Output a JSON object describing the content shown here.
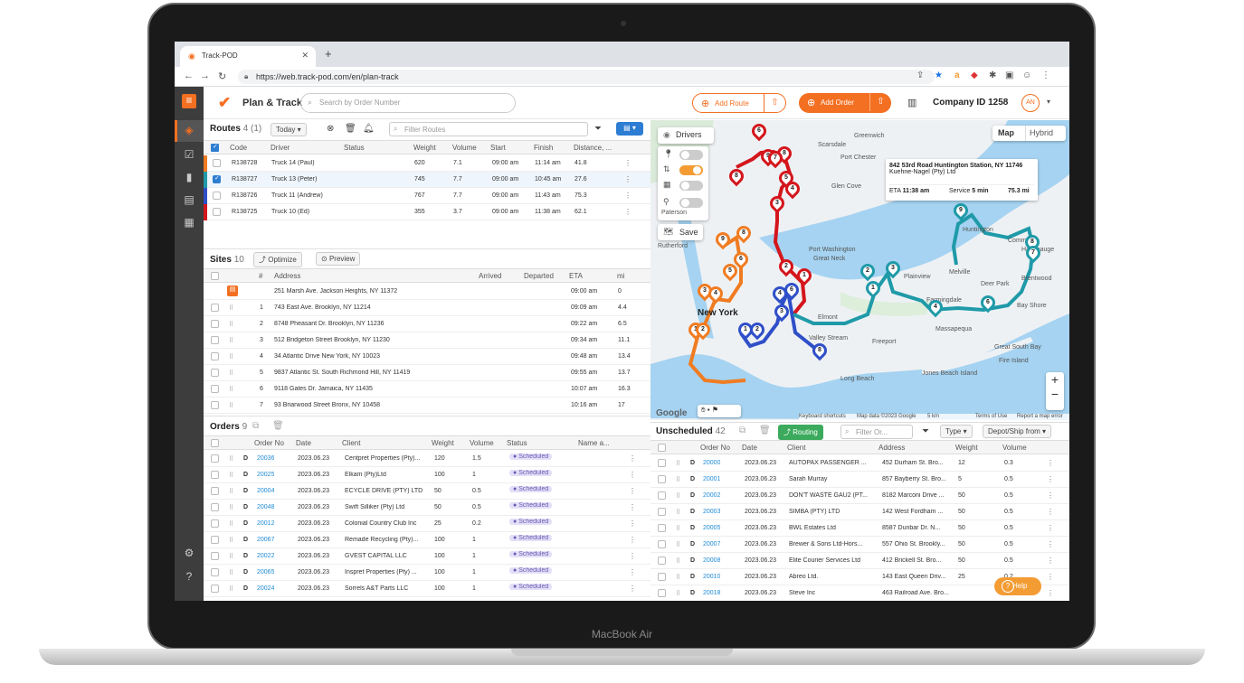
{
  "device": {
    "brand": "MacBook Air"
  },
  "browser": {
    "tab_title": "Track-POD",
    "url": "https://web.track-pod.com/en/plan-track"
  },
  "header": {
    "title": "Plan & Track",
    "search_placeholder": "Search by Order Number",
    "add_route": "Add Route",
    "add_order": "Add Order",
    "company": "Company ID 1258",
    "avatar": "AN"
  },
  "routes": {
    "title": "Routes",
    "count": "4 (1)",
    "period": "Today",
    "filter_placeholder": "Filter Routes",
    "columns": [
      "Code",
      "Driver",
      "Status",
      "Weight",
      "Volume",
      "Start",
      "Finish",
      "Distance, ..."
    ],
    "rows": [
      {
        "code": "R138728",
        "driver": "Truck 14 (Paul)",
        "weight": "620",
        "volume": "7.1",
        "start": "09:00 am",
        "finish": "11:14 am",
        "distance": "41.8",
        "color": "#f07c22",
        "checked": false
      },
      {
        "code": "R138727",
        "driver": "Truck 13 (Peter)",
        "weight": "745",
        "volume": "7.7",
        "start": "09:00 am",
        "finish": "10:45 am",
        "distance": "27.6",
        "color": "#1f9aa8",
        "checked": true
      },
      {
        "code": "R138726",
        "driver": "Truck 11 (Andrew)",
        "weight": "767",
        "volume": "7.7",
        "start": "09:00 am",
        "finish": "11:43 am",
        "distance": "75.3",
        "color": "#2f4fc8",
        "checked": false
      },
      {
        "code": "R138725",
        "driver": "Truck 10 (Ed)",
        "weight": "355",
        "volume": "3.7",
        "start": "09:00 am",
        "finish": "11:38 am",
        "distance": "62.1",
        "color": "#d4161c",
        "checked": false
      }
    ]
  },
  "sites": {
    "title": "Sites",
    "count": "10",
    "optimize": "Optimize",
    "preview": "Preview",
    "columns": [
      "#",
      "Address",
      "Arrived",
      "Departed",
      "ETA",
      "mi"
    ],
    "rows": [
      {
        "n": "",
        "address": "251 Marsh Ave. Jackson Heights, NY 11372",
        "eta": "09:00 am",
        "mi": "0",
        "depot": true
      },
      {
        "n": "1",
        "address": "743 East Ave. Brooklyn, NY 11214",
        "eta": "09:09 am",
        "mi": "4.4"
      },
      {
        "n": "2",
        "address": "8748 Pheasant Dr. Brooklyn, NY 11236",
        "eta": "09:22 am",
        "mi": "6.5"
      },
      {
        "n": "3",
        "address": "512 Bridgeton Street Brooklyn, NY 11230",
        "eta": "09:34 am",
        "mi": "11.1"
      },
      {
        "n": "4",
        "address": "34 Atlantic Drive New York, NY 10023",
        "eta": "09:48 am",
        "mi": "13.4"
      },
      {
        "n": "5",
        "address": "9837 Atlantic St. South Richmond Hill, NY 11419",
        "eta": "09:55 am",
        "mi": "13.7"
      },
      {
        "n": "6",
        "address": "9118 Gates Dr. Jamaica, NY 11435",
        "eta": "10:07 am",
        "mi": "16.3"
      },
      {
        "n": "7",
        "address": "93 Briarwood Street Bronx, NY 10458",
        "eta": "10:16 am",
        "mi": "17"
      }
    ]
  },
  "orders": {
    "title": "Orders",
    "count": "9",
    "columns": [
      "Order No",
      "Date",
      "Client",
      "Weight",
      "Volume",
      "Status",
      "Name a..."
    ],
    "rows": [
      {
        "no": "20036",
        "date": "2023.06.23",
        "client": "Centpret Properties (Pty)...",
        "weight": "120",
        "volume": "1.5",
        "status": "Scheduled"
      },
      {
        "no": "20025",
        "date": "2023.06.23",
        "client": "Elkam (Pty)Ltd",
        "weight": "100",
        "volume": "1",
        "status": "Scheduled"
      },
      {
        "no": "20004",
        "date": "2023.06.23",
        "client": "ECYCLE DRIVE (PTY) LTD",
        "weight": "50",
        "volume": "0.5",
        "status": "Scheduled"
      },
      {
        "no": "20048",
        "date": "2023.06.23",
        "client": "Swift Silliker (Pty) Ltd",
        "weight": "50",
        "volume": "0.5",
        "status": "Scheduled"
      },
      {
        "no": "20012",
        "date": "2023.06.23",
        "client": "Colonial Country Club Inc",
        "weight": "25",
        "volume": "0.2",
        "status": "Scheduled"
      },
      {
        "no": "20067",
        "date": "2023.06.23",
        "client": "Remade Recycling (Pty)...",
        "weight": "100",
        "volume": "1",
        "status": "Scheduled"
      },
      {
        "no": "20022",
        "date": "2023.06.23",
        "client": "GVEST CAPITAL LLC",
        "weight": "100",
        "volume": "1",
        "status": "Scheduled"
      },
      {
        "no": "20065",
        "date": "2023.06.23",
        "client": "Inspret Properties (Pty) ...",
        "weight": "100",
        "volume": "1",
        "status": "Scheduled"
      },
      {
        "no": "20024",
        "date": "2023.06.23",
        "client": "Sorrels A&T Parts LLC",
        "weight": "100",
        "volume": "1",
        "status": "Scheduled"
      }
    ]
  },
  "map": {
    "drivers_label": "Drivers",
    "save_label": "Save",
    "mode_map": "Map",
    "mode_hybrid": "Hybrid",
    "info_address": "842 53rd Road Huntington Station, NY 11746",
    "info_company": "Kuehne-Nagel (Pty) Ltd",
    "info_eta_label": "ETA",
    "info_eta": "11:38 am",
    "info_service_label": "Service",
    "info_service": "5 min",
    "info_distance": "75.3 mi",
    "places": [
      "Scarsdale",
      "Port Chester",
      "Greenwich",
      "Glen Cove",
      "Huntington",
      "Commack",
      "Hauppauge",
      "Port Washington",
      "Great Neck",
      "Rutherford",
      "Plainview",
      "Melville",
      "Brentwood",
      "Farmingdale",
      "Deer Park",
      "New York",
      "Elmont",
      "Bay Shore",
      "Massapequa",
      "Valley Stream",
      "Freeport",
      "Long Beach",
      "Great South Bay",
      "Fire Island",
      "Jones Beach Island",
      "Paterson"
    ],
    "google": "Google",
    "footer_shortcuts": "Keyboard shortcuts",
    "footer_data": "Map data ©2023 Google",
    "footer_scale": "5 km",
    "footer_terms": "Terms of Use",
    "footer_report": "Report a map error",
    "zoom_in": "+",
    "zoom_out": "−"
  },
  "unscheduled": {
    "title": "Unscheduled",
    "count": "42",
    "routing": "Routing",
    "filter_placeholder": "Filter Or...",
    "type": "Type",
    "depot": "Depot/Ship from",
    "columns": [
      "Order No",
      "Date",
      "Client",
      "Address",
      "Weight",
      "Volume"
    ],
    "rows": [
      {
        "no": "20000",
        "date": "2023.06.23",
        "client": "AUTOPAX PASSENGER ...",
        "address": "452 Durham St. Bro...",
        "weight": "12",
        "volume": "0.3"
      },
      {
        "no": "20001",
        "date": "2023.06.23",
        "client": "Sarah Murray",
        "address": "857 Bayberry St. Bro...",
        "weight": "5",
        "volume": "0.5"
      },
      {
        "no": "20002",
        "date": "2023.06.23",
        "client": "DON'T WASTE GAU2 (PT...",
        "address": "8182 Marconi Drive ...",
        "weight": "50",
        "volume": "0.5"
      },
      {
        "no": "20003",
        "date": "2023.06.23",
        "client": "SIMBA (PTY) LTD",
        "address": "142 West Fordham ...",
        "weight": "50",
        "volume": "0.5"
      },
      {
        "no": "20005",
        "date": "2023.06.23",
        "client": "BWL Estates Ltd",
        "address": "8587 Dunbar Dr. N...",
        "weight": "50",
        "volume": "0.5"
      },
      {
        "no": "20007",
        "date": "2023.06.23",
        "client": "Brewer & Sons Ltd-Hors...",
        "address": "557 Ohio St. Brookly...",
        "weight": "50",
        "volume": "0.5"
      },
      {
        "no": "20008",
        "date": "2023.06.23",
        "client": "Elite Courier Services Ltd",
        "address": "412 Brickell St. Bro...",
        "weight": "50",
        "volume": "0.5"
      },
      {
        "no": "20010",
        "date": "2023.06.23",
        "client": "Abreo Ltd.",
        "address": "143 East Queen Driv...",
        "weight": "25",
        "volume": "0.2"
      },
      {
        "no": "20018",
        "date": "2023.06.23",
        "client": "Steve Inc",
        "address": "463 Railroad Ave. Bro...",
        "weight": "",
        "volume": ""
      }
    ],
    "help": "Help"
  }
}
